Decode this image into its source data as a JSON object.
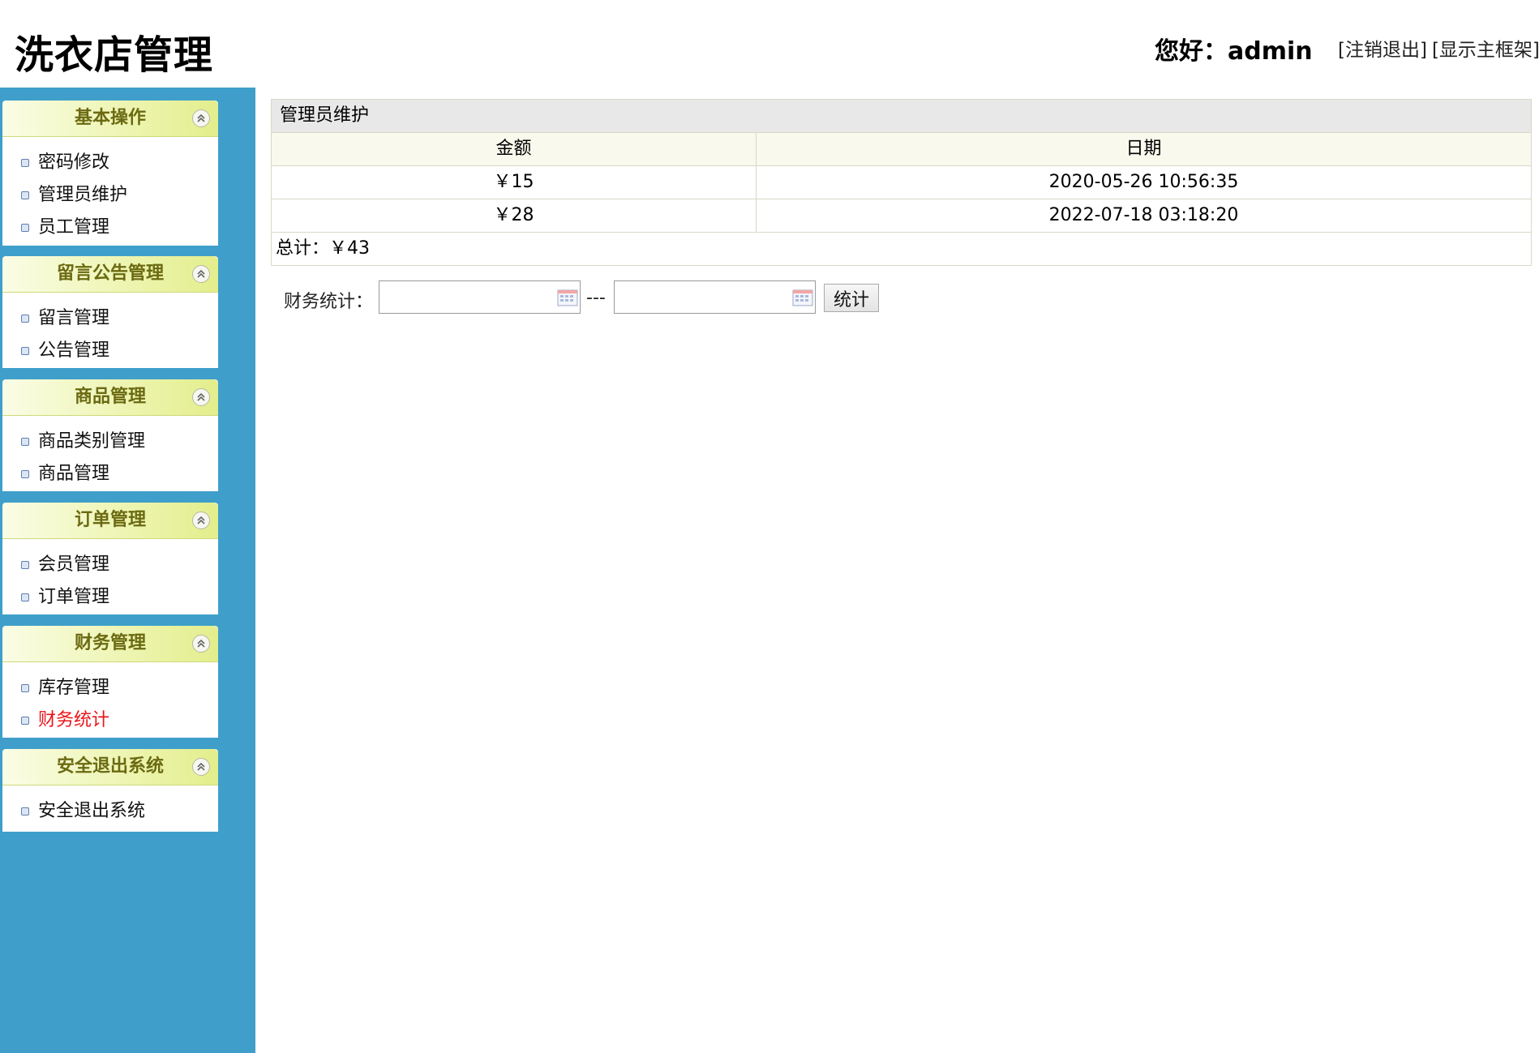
{
  "header": {
    "title": "洗衣店管理",
    "greeting": "您好：admin",
    "logout_link": "[注销退出]",
    "frame_link": "[显示主框架]"
  },
  "sidebar": {
    "groups": [
      {
        "title": "基本操作",
        "items": [
          "密码修改",
          "管理员维护",
          "员工管理"
        ]
      },
      {
        "title": "留言公告管理",
        "items": [
          "留言管理",
          "公告管理"
        ]
      },
      {
        "title": "商品管理",
        "items": [
          "商品类别管理",
          "商品管理"
        ]
      },
      {
        "title": "订单管理",
        "items": [
          "会员管理",
          "订单管理"
        ]
      },
      {
        "title": "财务管理",
        "items": [
          "库存管理",
          "财务统计"
        ],
        "active_item": "财务统计"
      },
      {
        "title": "安全退出系统",
        "items": [
          "安全退出系统"
        ]
      }
    ]
  },
  "main": {
    "caption": "管理员维护",
    "columns": [
      "金额",
      "日期"
    ],
    "rows": [
      {
        "amount": "￥15",
        "date": "2020-05-26 10:56:35"
      },
      {
        "amount": "￥28",
        "date": "2022-07-18 03:18:20"
      }
    ],
    "total": "总计：￥43"
  },
  "filter": {
    "label": "财务统计：",
    "start_value": "",
    "end_value": "",
    "separator": "---",
    "button_label": "统计"
  },
  "colors": {
    "sidebar_bg": "#3f9fca",
    "menu_header_text": "#6b6a12",
    "active_item": "#e8151b"
  }
}
